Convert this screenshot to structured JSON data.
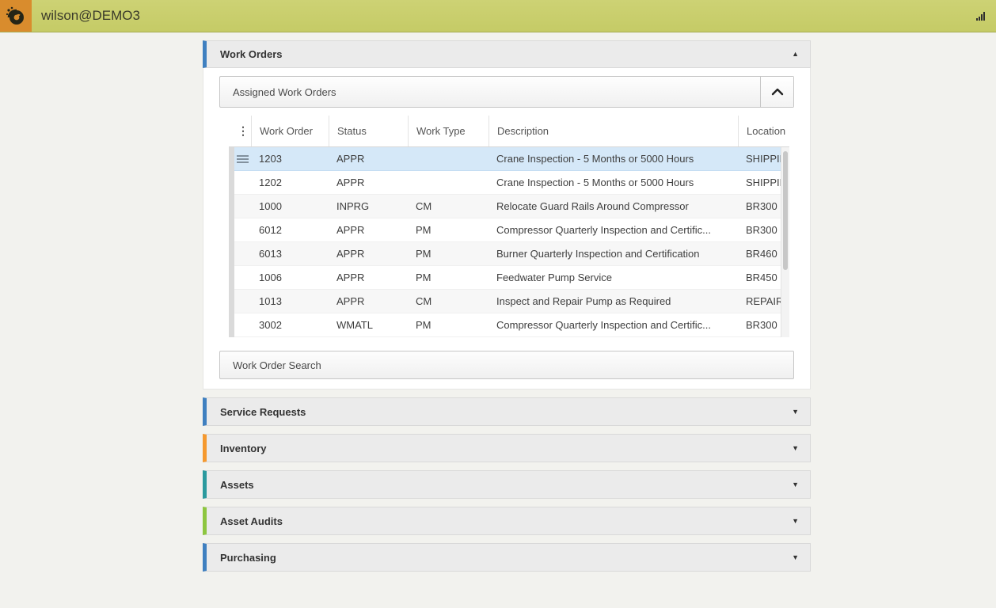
{
  "header": {
    "title": "wilson@DEMO3"
  },
  "icons": {
    "collapse_arrow": "▲",
    "expand_arrow": "▼",
    "column_menu": "⋮"
  },
  "colors": {
    "top_bar": "#c8ce6c",
    "logo_background": "#d98c2d",
    "selected_row": "#d5e8f8",
    "work_orders_stripe": "#3f80c0"
  },
  "work_orders": {
    "title": "Work Orders",
    "stripe": "#3f80c0",
    "assigned_panel": {
      "title": "Assigned Work Orders"
    },
    "search": {
      "label": "Work Order Search"
    },
    "table": {
      "columns": [
        "Work Order",
        "Status",
        "Work Type",
        "Description",
        "Location"
      ],
      "rows": [
        {
          "work_order": "1203",
          "status": "APPR",
          "work_type": "",
          "description": "Crane Inspection - 5 Months or 5000 Hours",
          "location": "SHIPPING",
          "selected": true
        },
        {
          "work_order": "1202",
          "status": "APPR",
          "work_type": "",
          "description": "Crane Inspection - 5 Months or 5000 Hours",
          "location": "SHIPPING"
        },
        {
          "work_order": "1000",
          "status": "INPRG",
          "work_type": "CM",
          "description": "Relocate Guard Rails Around Compressor",
          "location": "BR300"
        },
        {
          "work_order": "6012",
          "status": "APPR",
          "work_type": "PM",
          "description": "Compressor Quarterly Inspection and Certific...",
          "location": "BR300"
        },
        {
          "work_order": "6013",
          "status": "APPR",
          "work_type": "PM",
          "description": "Burner Quarterly Inspection and Certification",
          "location": "BR460"
        },
        {
          "work_order": "1006",
          "status": "APPR",
          "work_type": "PM",
          "description": "Feedwater Pump Service",
          "location": "BR450"
        },
        {
          "work_order": "1013",
          "status": "APPR",
          "work_type": "CM",
          "description": "Inspect and Repair Pump as Required",
          "location": "REPAIR"
        },
        {
          "work_order": "3002",
          "status": "WMATL",
          "work_type": "PM",
          "description": "Compressor Quarterly Inspection and Certific...",
          "location": "BR300"
        }
      ]
    }
  },
  "sections": [
    {
      "label": "Service Requests",
      "stripe": "#3f80c0"
    },
    {
      "label": "Inventory",
      "stripe": "#f5992e"
    },
    {
      "label": "Assets",
      "stripe": "#2b9a9e"
    },
    {
      "label": "Asset Audits",
      "stripe": "#8dc63f"
    },
    {
      "label": "Purchasing",
      "stripe": "#3f80c0"
    }
  ]
}
